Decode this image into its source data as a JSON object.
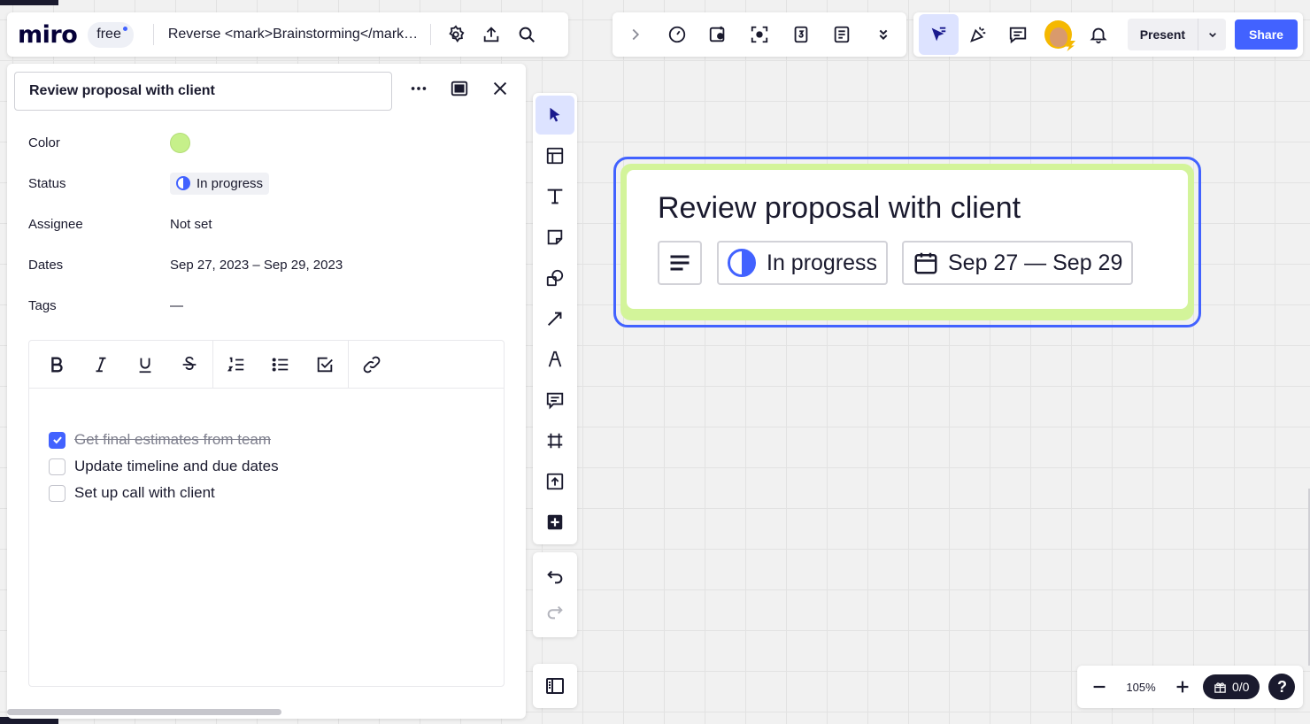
{
  "app": {
    "logo": "miro",
    "plan": "free",
    "board_title": "Reverse <mark>Brainstorming</mark> template"
  },
  "top_right": {
    "present_label": "Present",
    "share_label": "Share"
  },
  "detail_panel": {
    "title_value": "Review proposal with client",
    "properties": {
      "color_label": "Color",
      "color_value": "#c6f08a",
      "status_label": "Status",
      "status_value": "In progress",
      "assignee_label": "Assignee",
      "assignee_value": "Not set",
      "dates_label": "Dates",
      "dates_value": "Sep 27, 2023 – Sep 29, 2023",
      "tags_label": "Tags",
      "tags_value": "—"
    },
    "checklist": [
      {
        "text": "Get final estimates from team",
        "checked": true
      },
      {
        "text": "Update timeline and due dates",
        "checked": false
      },
      {
        "text": "Set up call with client",
        "checked": false
      }
    ]
  },
  "card": {
    "title": "Review proposal with client",
    "status": "In progress",
    "dates": "Sep 27 — Sep 29",
    "color": "#d3f49a"
  },
  "zoom": {
    "level": "105%",
    "gift_count": "0/0",
    "help": "?"
  },
  "colors": {
    "accent": "#4262ff",
    "dark": "#1a1a2e"
  }
}
